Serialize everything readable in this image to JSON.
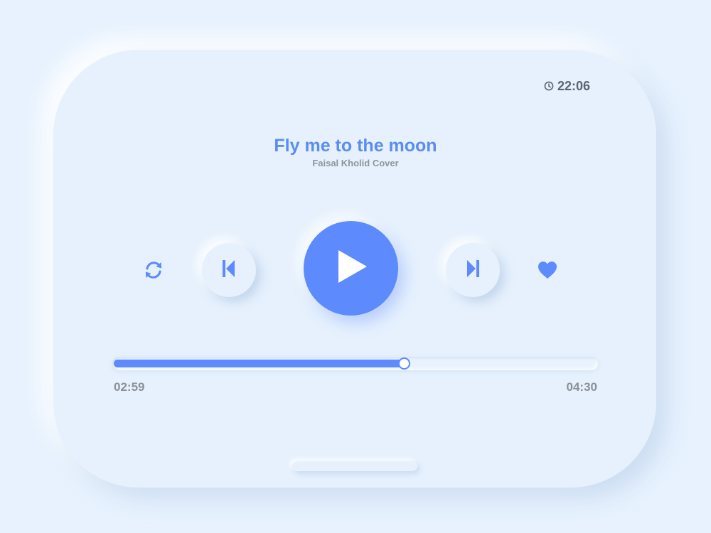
{
  "status": {
    "time": "22:06",
    "clock_icon": "clock-icon"
  },
  "track": {
    "title": "Fly me to the moon",
    "artist": "Faisal Kholid Cover"
  },
  "controls": {
    "repeat_icon": "repeat-icon",
    "previous_icon": "skip-previous-icon",
    "play_icon": "play-icon",
    "next_icon": "skip-next-icon",
    "like_icon": "heart-icon"
  },
  "progress": {
    "elapsed": "02:59",
    "total": "04:30",
    "fraction": 0.6
  },
  "colors": {
    "accent": "#5d8afc",
    "title": "#5a8dee",
    "background": "#e7f2fe",
    "muted_text": "#8b9098"
  }
}
